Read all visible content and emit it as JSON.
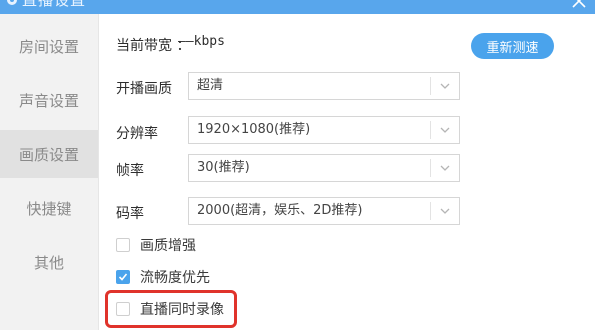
{
  "window": {
    "title": "直播设置",
    "close_glyph": "✕"
  },
  "sidebar": {
    "items": [
      {
        "label": "房间设置",
        "active": false
      },
      {
        "label": "声音设置",
        "active": false
      },
      {
        "label": "画质设置",
        "active": true
      },
      {
        "label": "快捷键",
        "active": false
      },
      {
        "label": "其他",
        "active": false
      }
    ]
  },
  "bandwidth": {
    "label": "当前带宽 ：",
    "value": "——kbps",
    "retest_button": "重新测速"
  },
  "settings": {
    "quality": {
      "label": "开播画质",
      "value": "超清"
    },
    "resolution": {
      "label": "分辨率",
      "value": "1920×1080(推荐)"
    },
    "framerate": {
      "label": "帧率",
      "value": "30(推荐)"
    },
    "bitrate": {
      "label": "码率",
      "value": "2000(超清，娱乐、2D推荐)"
    }
  },
  "options": {
    "enhance": {
      "label": "画质增强",
      "checked": false
    },
    "smooth": {
      "label": "流畅度优先",
      "checked": true
    },
    "record": {
      "label": "直播同时录像",
      "checked": false
    }
  },
  "colors": {
    "accent": "#4aa3ec",
    "highlight": "#e0332b"
  }
}
